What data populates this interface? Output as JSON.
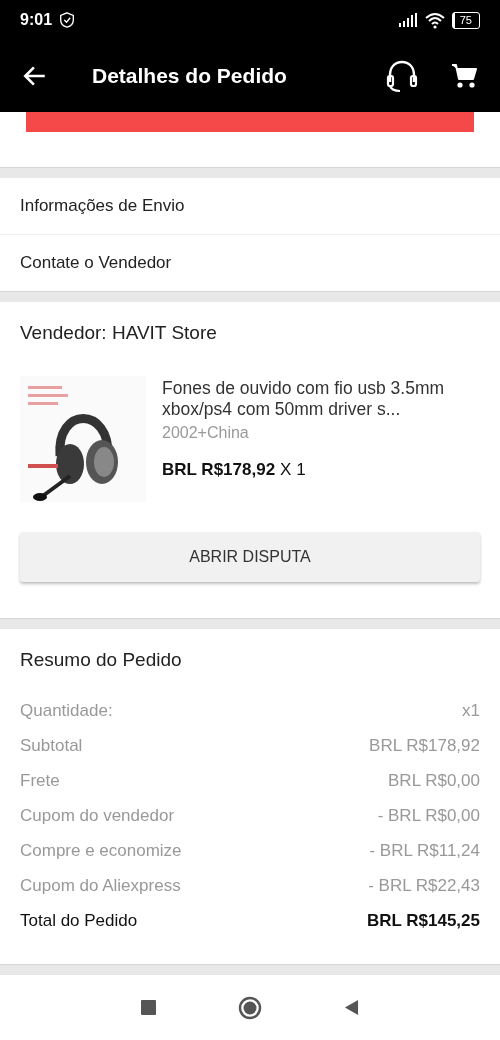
{
  "status_bar": {
    "time": "9:01",
    "battery": "75"
  },
  "header": {
    "title": "Detalhes do Pedido"
  },
  "top_action": {
    "kind": "partially-hidden-button"
  },
  "links": [
    {
      "label": "Informações de Envio"
    },
    {
      "label": "Contate o Vendedor"
    }
  ],
  "seller": {
    "title": "Vendedor: HAVIT Store",
    "product": {
      "name": "Fones de ouvido com fio usb 3.5mm xbox/ps4 com 50mm driver s...",
      "variant": "2002+China",
      "price": "BRL R$178,92",
      "quantity": "X 1"
    },
    "dispute_button": "ABRIR DISPUTA"
  },
  "summary": {
    "title": "Resumo do Pedido",
    "rows": [
      {
        "label": "Quantidade:",
        "value": "x1",
        "kind": "normal"
      },
      {
        "label": "Subtotal",
        "value": "BRL R$178,92",
        "kind": "normal"
      },
      {
        "label": "Frete",
        "value": "BRL R$0,00",
        "kind": "normal"
      },
      {
        "label": "Cupom do vendedor",
        "value": "- BRL R$0,00",
        "kind": "normal"
      },
      {
        "label": "Compre e economize",
        "value": "- BRL R$11,24",
        "kind": "normal"
      },
      {
        "label": "Cupom do Aliexpress",
        "value": "- BRL R$22,43",
        "kind": "normal"
      },
      {
        "label": "Total do Pedido",
        "value": "BRL R$145,25",
        "kind": "total"
      }
    ]
  }
}
